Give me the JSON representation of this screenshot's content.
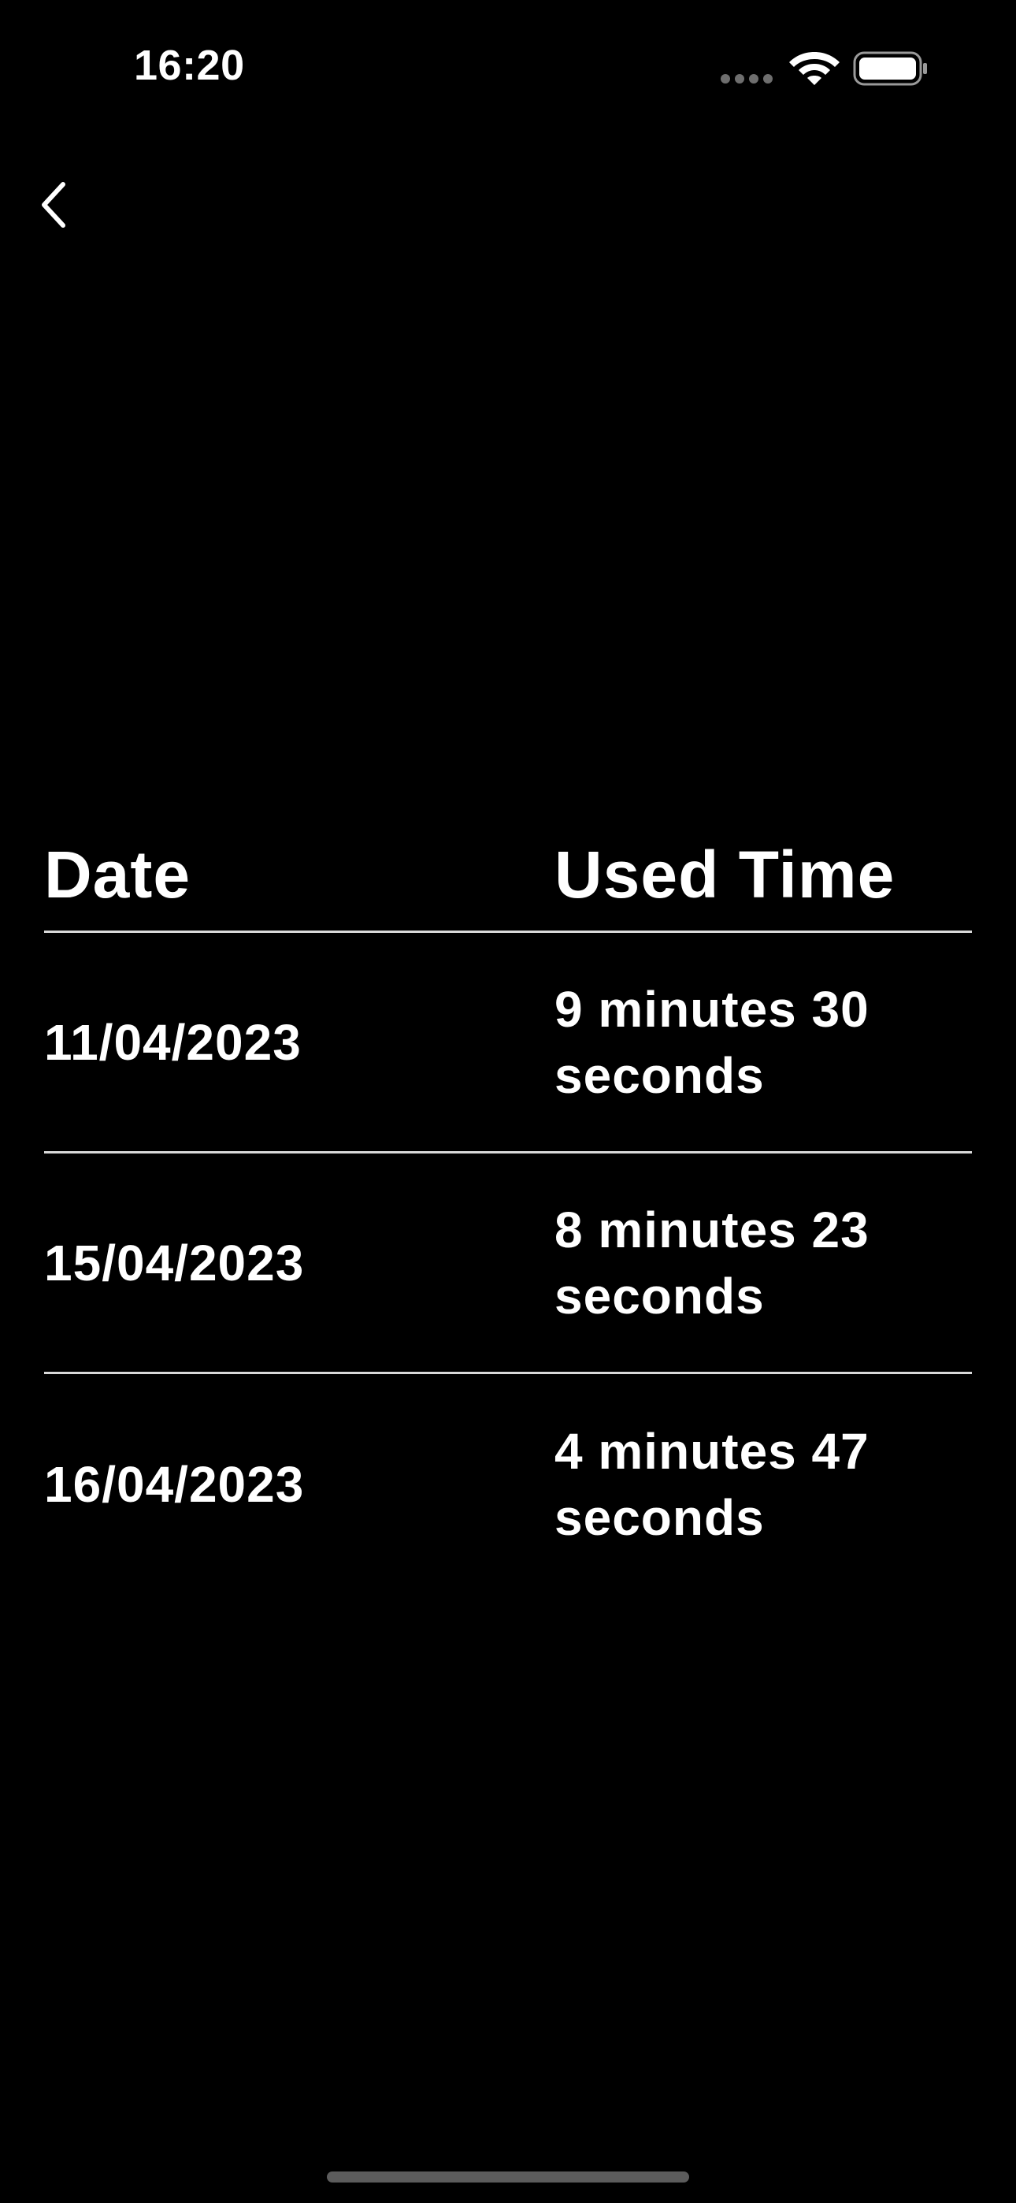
{
  "status_bar": {
    "time": "16:20",
    "icons": [
      "signal-dots-icon",
      "wifi-icon",
      "battery-icon"
    ]
  },
  "nav": {
    "back_icon": "chevron-left-icon"
  },
  "table": {
    "headers": {
      "date": "Date",
      "used_time": "Used Time"
    },
    "rows": [
      {
        "date": "11/04/2023",
        "used_time": "9 minutes 30 seconds"
      },
      {
        "date": "15/04/2023",
        "used_time": "8 minutes 23 seconds"
      },
      {
        "date": "16/04/2023",
        "used_time": "4 minutes 47 seconds"
      }
    ]
  },
  "colors": {
    "background": "#000000",
    "text": "#ffffff",
    "divider": "#d9d9d9"
  }
}
